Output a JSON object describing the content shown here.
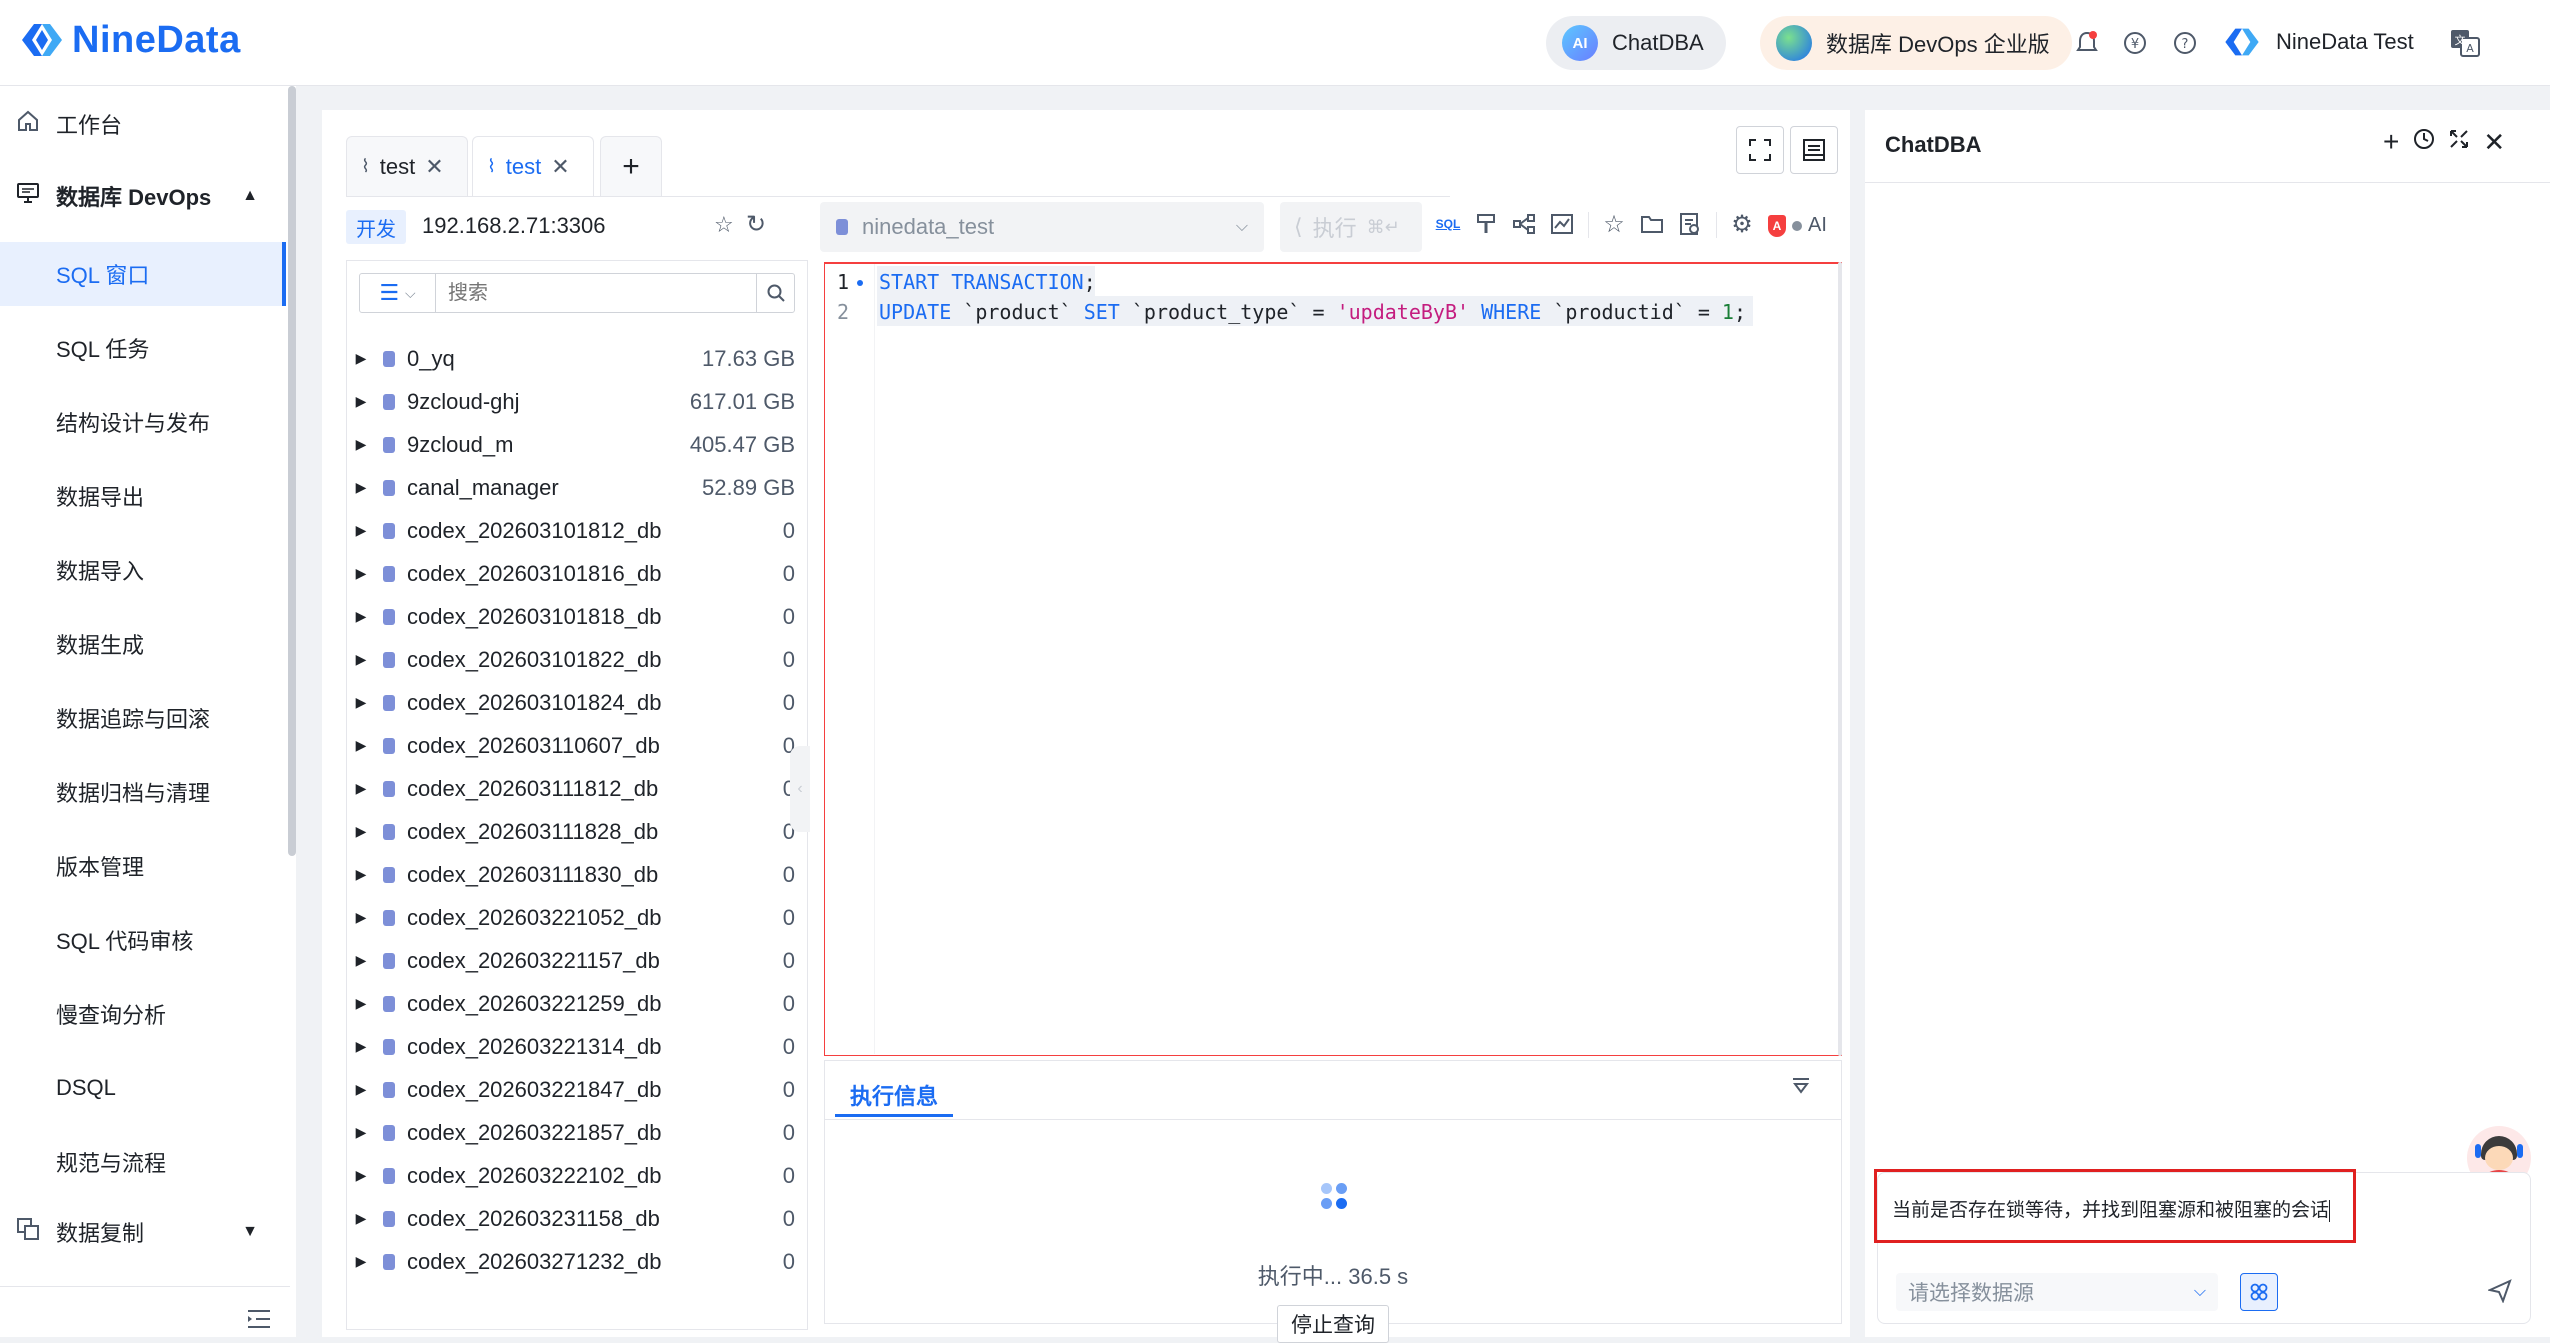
{
  "header": {
    "brand": "NineData",
    "chatdba_label": "ChatDBA",
    "edition_label": "数据库 DevOps 企业版",
    "user_name": "NineData Test",
    "icons": [
      "bell-icon",
      "yen-icon",
      "help-icon",
      "translate-icon"
    ],
    "accent": "#1b6cf2"
  },
  "sidebar": {
    "items": [
      {
        "label": "工作台",
        "icon": "home-icon"
      },
      {
        "label": "数据库 DevOps",
        "icon": "monitor-icon",
        "expanded": true
      },
      {
        "label": "SQL 窗口",
        "active": true
      },
      {
        "label": "SQL 任务"
      },
      {
        "label": "结构设计与发布"
      },
      {
        "label": "数据导出"
      },
      {
        "label": "数据导入"
      },
      {
        "label": "数据生成"
      },
      {
        "label": "数据追踪与回滚"
      },
      {
        "label": "数据归档与清理"
      },
      {
        "label": "版本管理"
      },
      {
        "label": "SQL 代码审核"
      },
      {
        "label": "慢查询分析"
      },
      {
        "label": "DSQL"
      },
      {
        "label": "规范与流程"
      },
      {
        "label": "数据复制",
        "icon": "copy-icon"
      }
    ]
  },
  "tabs": [
    {
      "label": "test",
      "selected": false
    },
    {
      "label": "test",
      "selected": true
    }
  ],
  "connection": {
    "env_badge": "开发",
    "address": "192.168.2.71:3306",
    "database": "ninedata_test",
    "execute_label": "执行",
    "execute_shortcut": "⌘↵",
    "ai_label": "AI"
  },
  "tree": {
    "search_placeholder": "搜索",
    "databases": [
      {
        "name": "0_yq",
        "size": "17.63 GB"
      },
      {
        "name": "9zcloud-ghj",
        "size": "617.01 GB"
      },
      {
        "name": "9zcloud_m",
        "size": "405.47 GB"
      },
      {
        "name": "canal_manager",
        "size": "52.89 GB"
      },
      {
        "name": "codex_202603101812_db",
        "size": "0"
      },
      {
        "name": "codex_202603101816_db",
        "size": "0"
      },
      {
        "name": "codex_202603101818_db",
        "size": "0"
      },
      {
        "name": "codex_202603101822_db",
        "size": "0"
      },
      {
        "name": "codex_202603101824_db",
        "size": "0"
      },
      {
        "name": "codex_202603110607_db",
        "size": "0"
      },
      {
        "name": "codex_202603111812_db",
        "size": "0"
      },
      {
        "name": "codex_202603111828_db",
        "size": "0"
      },
      {
        "name": "codex_202603111830_db",
        "size": "0"
      },
      {
        "name": "codex_202603221052_db",
        "size": "0"
      },
      {
        "name": "codex_202603221157_db",
        "size": "0"
      },
      {
        "name": "codex_202603221259_db",
        "size": "0"
      },
      {
        "name": "codex_202603221314_db",
        "size": "0"
      },
      {
        "name": "codex_202603221847_db",
        "size": "0"
      },
      {
        "name": "codex_202603221857_db",
        "size": "0"
      },
      {
        "name": "codex_202603222102_db",
        "size": "0"
      },
      {
        "name": "codex_202603231158_db",
        "size": "0"
      },
      {
        "name": "codex_202603271232_db",
        "size": "0"
      }
    ]
  },
  "editor": {
    "line_numbers": [
      "1",
      "2"
    ],
    "line1": {
      "kw": "START TRANSACTION",
      "end": ";"
    },
    "line2": {
      "kw1": "UPDATE",
      "t1": " `product` ",
      "kw2": "SET",
      "t2": " `product_type` = ",
      "str": "'updateByB'",
      "t3": " ",
      "kw3": "WHERE",
      "t4": " `productid` = ",
      "num": "1",
      "end": ";"
    }
  },
  "result": {
    "tab_label": "执行信息",
    "running_text": "执行中... 36.5 s",
    "stop_label": "停止查询"
  },
  "chat": {
    "title": "ChatDBA",
    "input_text": "当前是否存在锁等待，并找到阻塞源和被阻塞的会话",
    "datasource_placeholder": "请选择数据源",
    "highlight_color": "#e02020"
  }
}
